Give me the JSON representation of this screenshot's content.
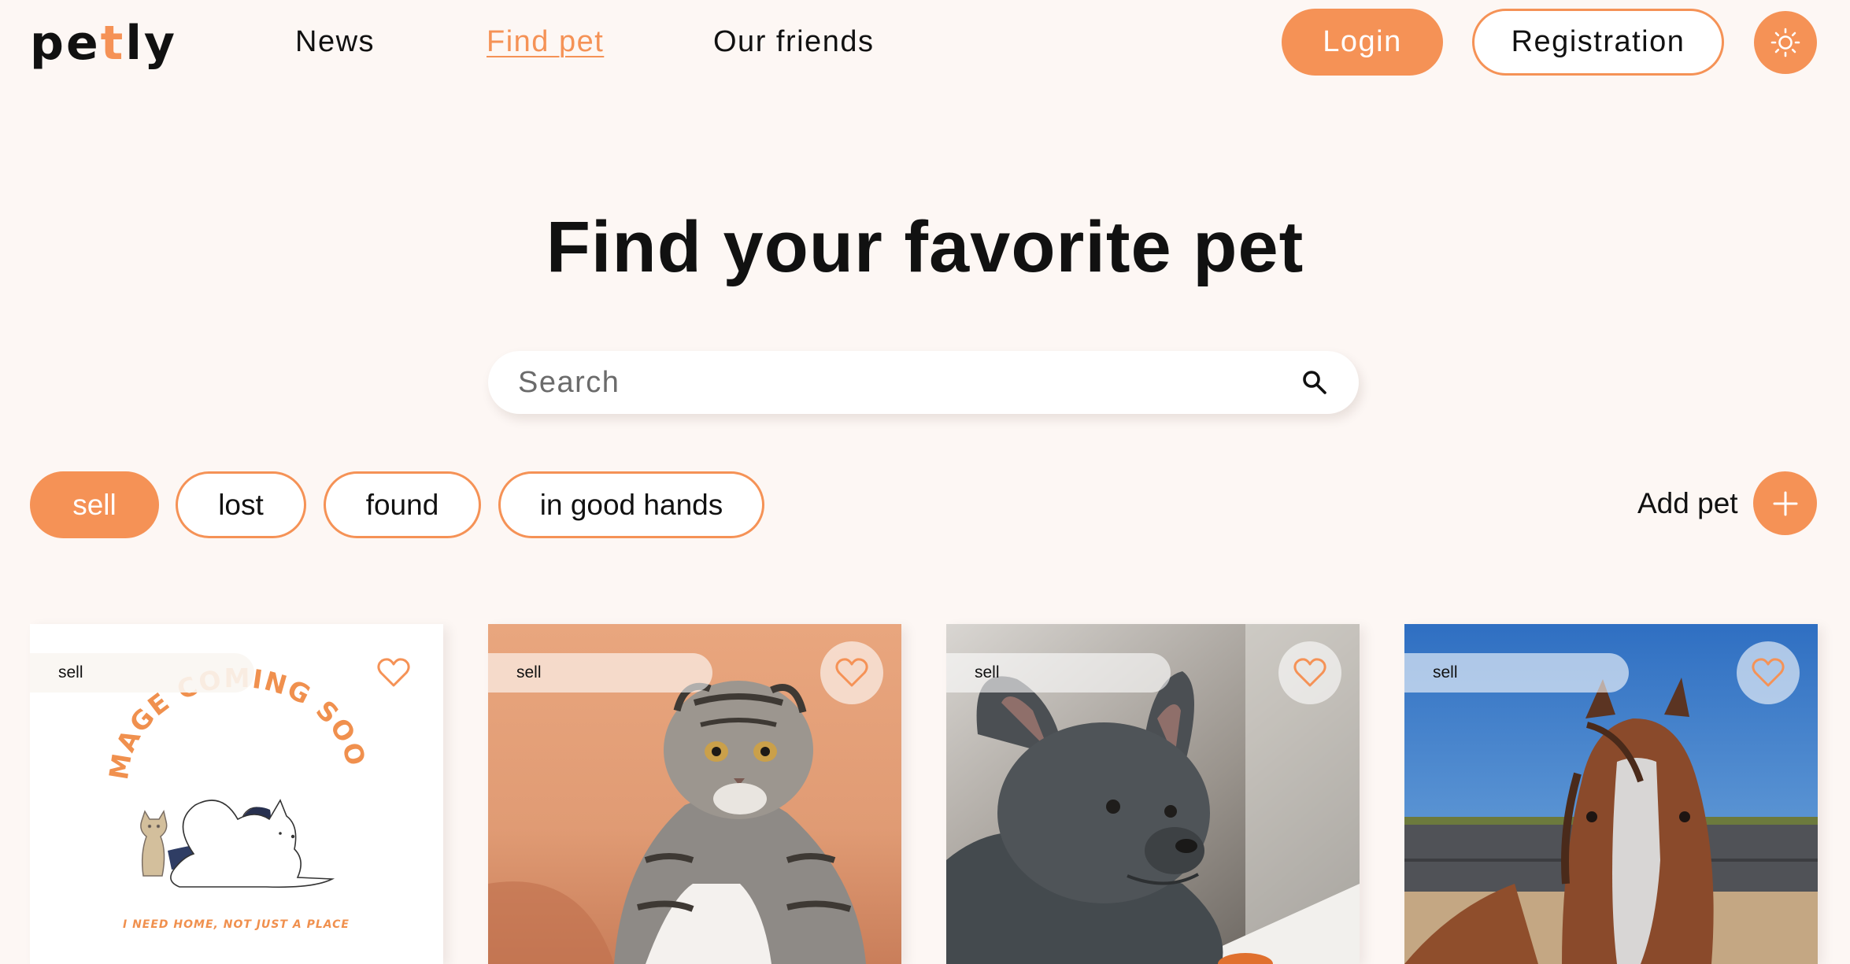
{
  "brand": {
    "logo_pre": "pe",
    "logo_accent": "t",
    "logo_post": "ly"
  },
  "nav": {
    "links": [
      {
        "label": "News",
        "active": false
      },
      {
        "label": "Find pet",
        "active": true
      },
      {
        "label": "Our friends",
        "active": false
      }
    ]
  },
  "auth": {
    "login_label": "Login",
    "registration_label": "Registration"
  },
  "theme_toggle": {
    "icon": "sun-icon"
  },
  "hero": {
    "title": "Find your favorite pet"
  },
  "search": {
    "placeholder": "Search",
    "value": "",
    "icon": "search-icon"
  },
  "filters": {
    "categories": [
      {
        "label": "sell",
        "selected": true
      },
      {
        "label": "lost",
        "selected": false
      },
      {
        "label": "found",
        "selected": false
      },
      {
        "label": "in good hands",
        "selected": false
      }
    ],
    "add_pet_label": "Add pet",
    "add_pet_icon": "plus-icon"
  },
  "placeholder_image": {
    "arc_text": "IMAGE COMING SOON",
    "caption": "I NEED HOME, NOT JUST A PLACE"
  },
  "cards": [
    {
      "category": "sell",
      "image": "placeholder-illustration",
      "favorite": false
    },
    {
      "category": "sell",
      "image": "tabby-scottish-fold-cat-photo",
      "favorite": false
    },
    {
      "category": "sell",
      "image": "french-bulldog-photo",
      "favorite": false
    },
    {
      "category": "sell",
      "image": "brown-horse-photo",
      "favorite": false
    }
  ],
  "colors": {
    "accent": "#f59256",
    "background": "#fdf7f4",
    "text": "#111111",
    "white": "#ffffff"
  }
}
